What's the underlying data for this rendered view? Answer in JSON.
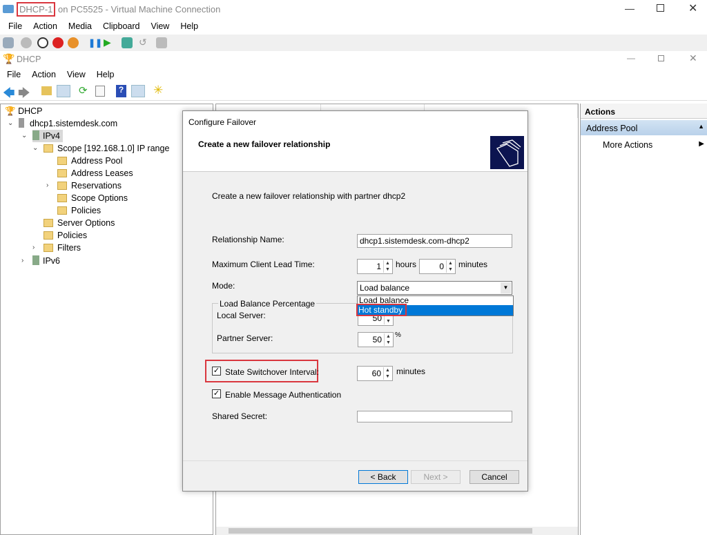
{
  "vm": {
    "title_highlight": "DHCP-1",
    "title_rest": " on PC5525 - Virtual Machine Connection",
    "menu": [
      "File",
      "Action",
      "Media",
      "Clipboard",
      "View",
      "Help"
    ]
  },
  "mmc": {
    "title": "DHCP",
    "menu": [
      "File",
      "Action",
      "View",
      "Help"
    ]
  },
  "tree": [
    {
      "label": "DHCP"
    },
    {
      "label": "dhcp1.sistemdesk.com"
    },
    {
      "label": "IPv4"
    },
    {
      "label": "Scope [192.168.1.0] IP range"
    },
    {
      "label": "Address Pool"
    },
    {
      "label": "Address Leases"
    },
    {
      "label": "Reservations"
    },
    {
      "label": "Scope Options"
    },
    {
      "label": "Policies"
    },
    {
      "label": "Server Options"
    },
    {
      "label": "Policies"
    },
    {
      "label": "Filters"
    },
    {
      "label": "IPv6"
    }
  ],
  "actions": {
    "header": "Actions",
    "section": "Address Pool",
    "item": "More Actions"
  },
  "dialog": {
    "title": "Configure Failover",
    "heading": "Create a new failover relationship",
    "intro": "Create a new failover relationship with partner dhcp2",
    "relationship_label": "Relationship Name:",
    "relationship_value": "dhcp1.sistemdesk.com-dhcp2",
    "mclt_label": "Maximum Client Lead Time:",
    "mclt_hours": "1",
    "hours": "hours",
    "mclt_minutes": "0",
    "minutes": "minutes",
    "mode_label": "Mode:",
    "mode_value": "Load balance",
    "mode_options": [
      "Load balance",
      "Hot standby"
    ],
    "lb_group": "Load Balance Percentage",
    "local_label": "Local Server:",
    "local_value": "50",
    "partner_label": "Partner Server:",
    "partner_value": "50",
    "percent": "%",
    "ssi_label": "State Switchover Interval:",
    "ssi_checked": true,
    "ssi_value": "60",
    "ssi_unit": "minutes",
    "auth_label": "Enable Message Authentication",
    "auth_checked": true,
    "secret_label": "Shared Secret:",
    "secret_value": "",
    "back": "< Back",
    "next": "Next >",
    "cancel": "Cancel"
  },
  "colors": {
    "highlight": "#d9363e",
    "selection": "#0078d7"
  }
}
